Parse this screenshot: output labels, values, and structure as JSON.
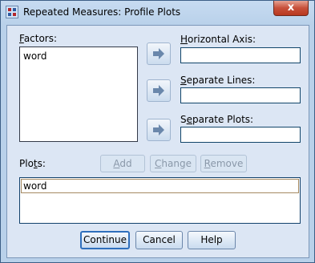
{
  "window": {
    "title": "Repeated Measures: Profile Plots",
    "close_glyph": "x"
  },
  "factors": {
    "label_mnemonic": "F",
    "label_rest": "actors:",
    "items": [
      "word"
    ]
  },
  "horizontal_axis": {
    "label_mnemonic": "H",
    "label_rest": "orizontal Axis:",
    "value": ""
  },
  "separate_lines": {
    "label_mnemonic": "S",
    "label_rest": "eparate Lines:",
    "value": ""
  },
  "separate_plots": {
    "label_pre": "S",
    "label_mnemonic": "e",
    "label_rest": "parate Plots:",
    "value": ""
  },
  "plots": {
    "label_pre": "Plo",
    "label_mnemonic": "t",
    "label_rest": "s:",
    "items": [
      "word"
    ],
    "add": {
      "mnemonic": "A",
      "rest": "dd"
    },
    "change": {
      "mnemonic": "C",
      "rest": "hange"
    },
    "remove": {
      "mnemonic": "R",
      "rest": "emove"
    }
  },
  "buttons": {
    "continue": "Continue",
    "cancel": "Cancel",
    "help": "Help"
  },
  "icons": {
    "arrow": "right-arrow-icon",
    "app": "spss-grid-icon"
  },
  "colors": {
    "window_frame": "#b9d1ea",
    "client_bg": "#dce6f4",
    "close_red": "#c7503a",
    "default_button_border": "#2f6fbc"
  }
}
